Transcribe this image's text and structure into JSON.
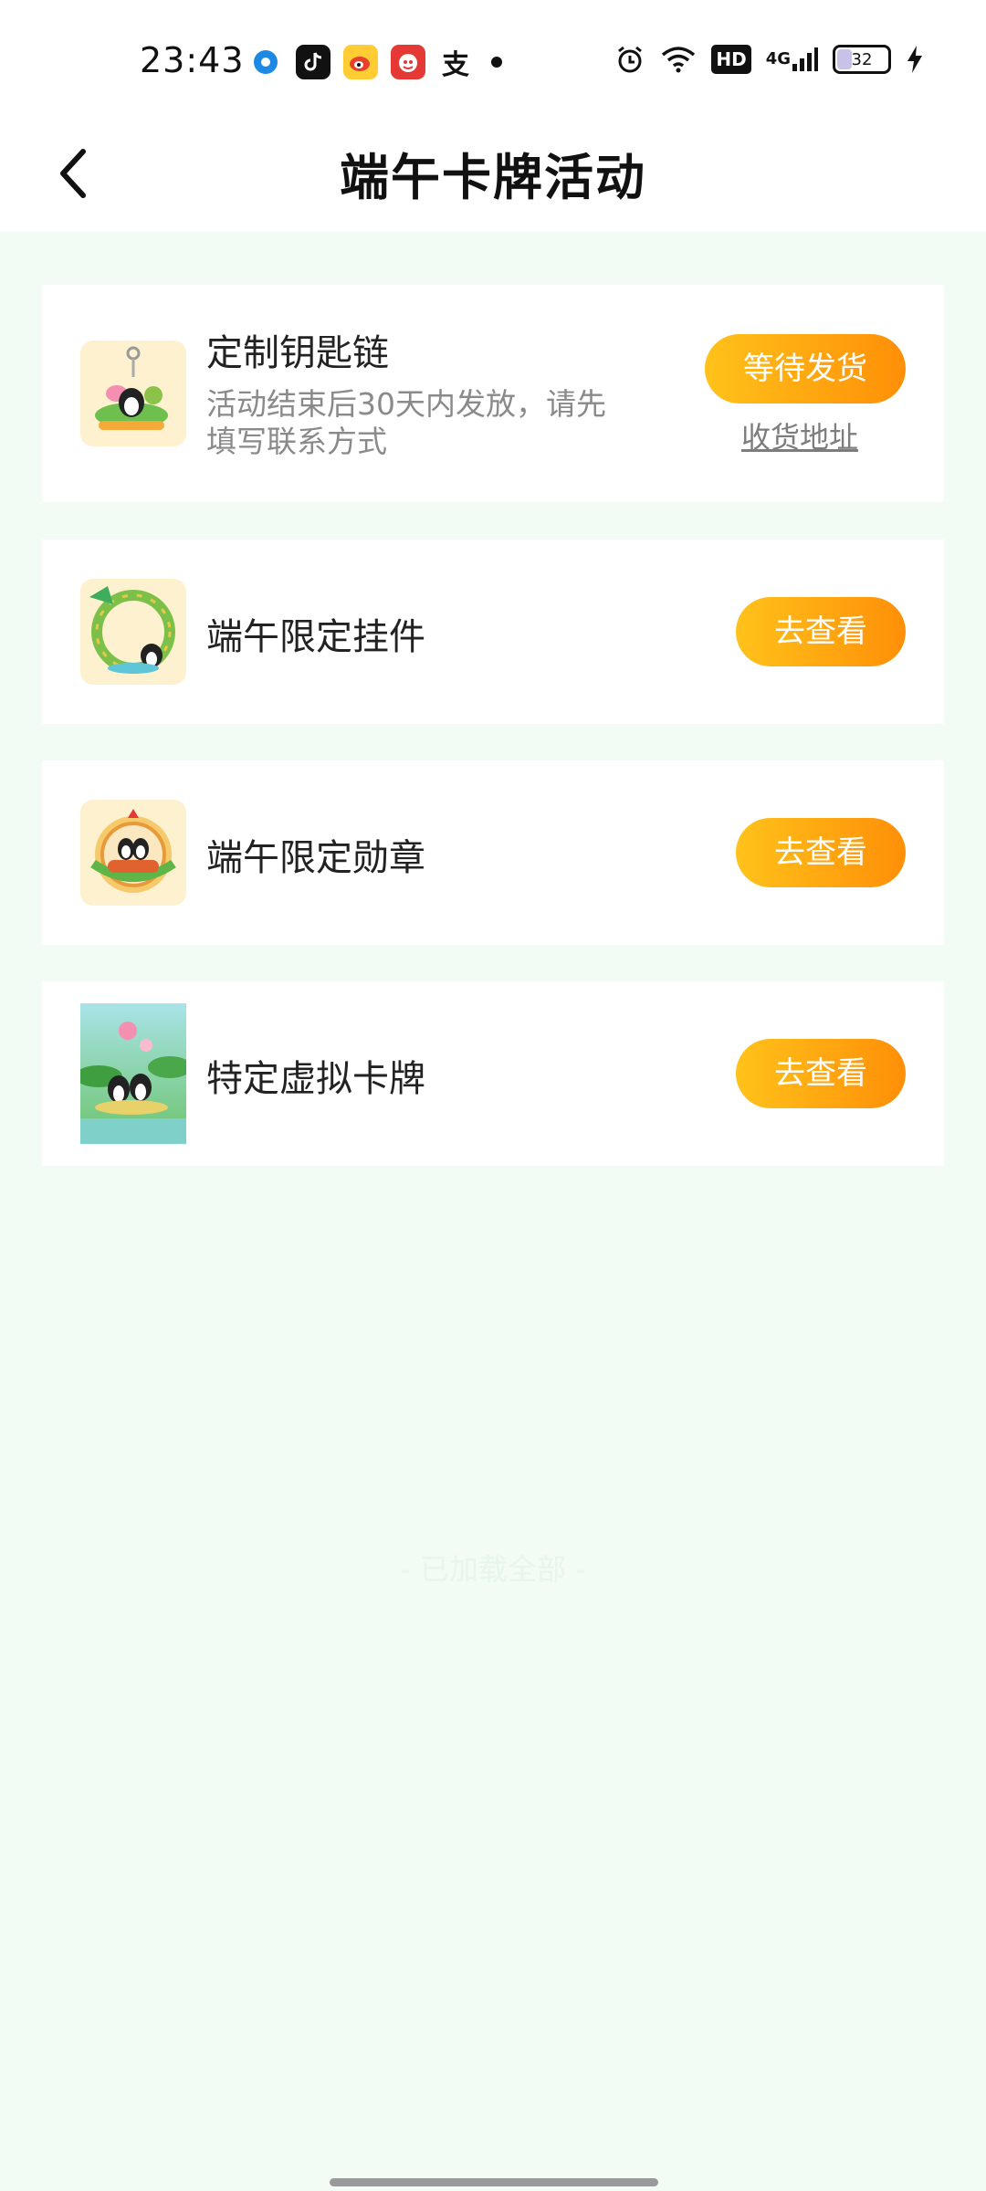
{
  "status_bar": {
    "time": "23:43",
    "app_icons": [
      "browser-icon",
      "tiktok-icon",
      "weibo-icon",
      "pinduoduo-icon",
      "alipay-icon"
    ],
    "alipay_glyph": "支",
    "battery_level": "32",
    "network": "4G",
    "hd_label": "HD"
  },
  "header": {
    "title": "端午卡牌活动",
    "back_icon": "chevron-left-icon"
  },
  "items": [
    {
      "title": "定制钥匙链",
      "description": "活动结束后30天内发放，请先填写联系方式",
      "button_label": "等待发货",
      "link_label": "收货地址"
    },
    {
      "title": "端午限定挂件",
      "button_label": "去查看"
    },
    {
      "title": "端午限定勋章",
      "button_label": "去查看"
    },
    {
      "title": "特定虚拟卡牌",
      "button_label": "去查看"
    }
  ],
  "footer": {
    "text": "- 已加载全部 -"
  },
  "colors": {
    "page_bg": "#f2fbf4",
    "button_gradient_start": "#ffc21a",
    "button_gradient_end": "#ff8f08"
  }
}
